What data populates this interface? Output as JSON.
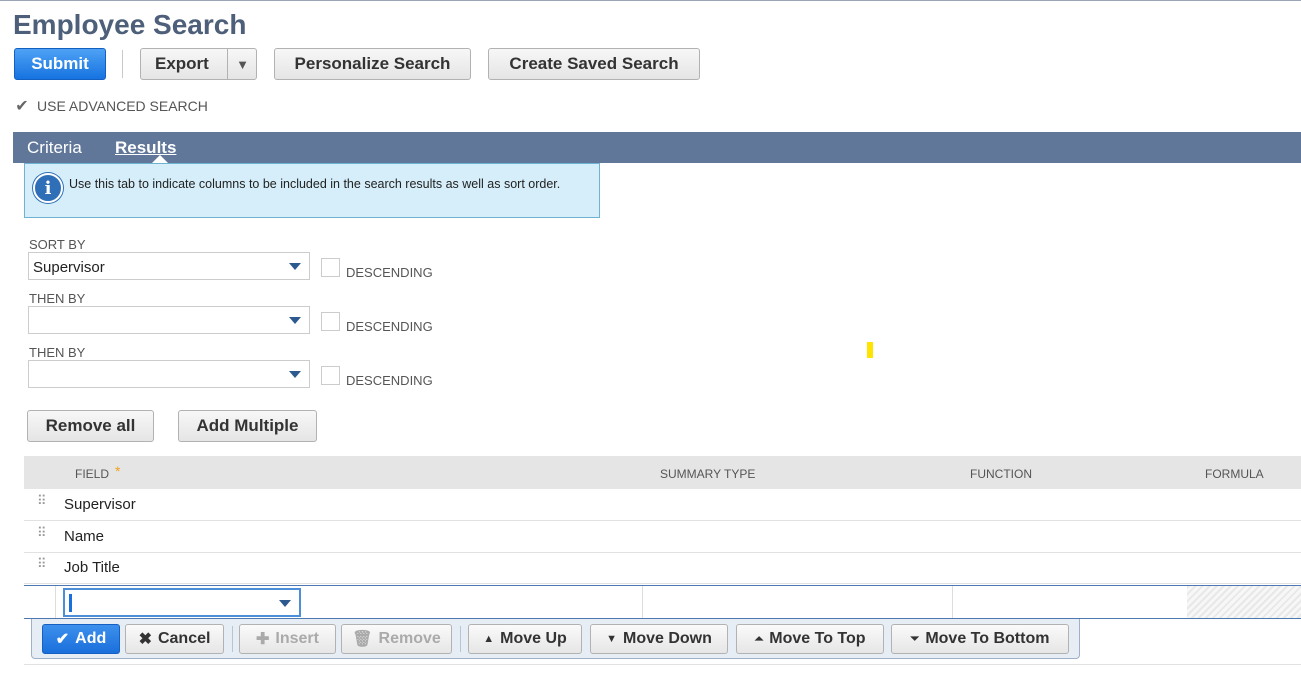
{
  "page": {
    "title": "Employee Search"
  },
  "toolbar": {
    "submit": "Submit",
    "export": "Export",
    "export_dropdown_icon": "▼",
    "personalize": "Personalize Search",
    "create_saved": "Create Saved Search"
  },
  "advanced_search": {
    "label": "USE ADVANCED SEARCH",
    "checked": true,
    "icon": "checkmark-icon"
  },
  "tabs": [
    {
      "label": "Criteria",
      "active": false
    },
    {
      "label": "Results",
      "active": true
    }
  ],
  "info": {
    "text": "Use this tab to indicate columns to be included in the search results as well as sort order.",
    "icon": "info-icon"
  },
  "sort": [
    {
      "label": "SORT BY",
      "value": "Supervisor",
      "descending_label": "DESCENDING",
      "descending": false
    },
    {
      "label": "THEN BY",
      "value": "",
      "descending_label": "DESCENDING",
      "descending": false
    },
    {
      "label": "THEN BY",
      "value": "",
      "descending_label": "DESCENDING",
      "descending": false
    }
  ],
  "list_buttons": {
    "remove_all": "Remove all",
    "add_multiple": "Add Multiple"
  },
  "grid": {
    "columns": [
      "FIELD",
      "SUMMARY TYPE",
      "FUNCTION",
      "FORMULA"
    ],
    "required_marker": "*",
    "rows": [
      {
        "field": "Supervisor"
      },
      {
        "field": "Name"
      },
      {
        "field": "Job Title"
      }
    ],
    "edit_row_value": ""
  },
  "row_actions": {
    "add": "Add",
    "cancel": "Cancel",
    "insert": "Insert",
    "remove": "Remove",
    "move_up": "Move Up",
    "move_down": "Move Down",
    "move_to_top": "Move To Top",
    "move_to_bottom": "Move To Bottom"
  },
  "colors": {
    "primary": "#1673e0",
    "tabbar": "#607799",
    "title": "#4d5f79",
    "info_bg": "#d5eef9"
  }
}
